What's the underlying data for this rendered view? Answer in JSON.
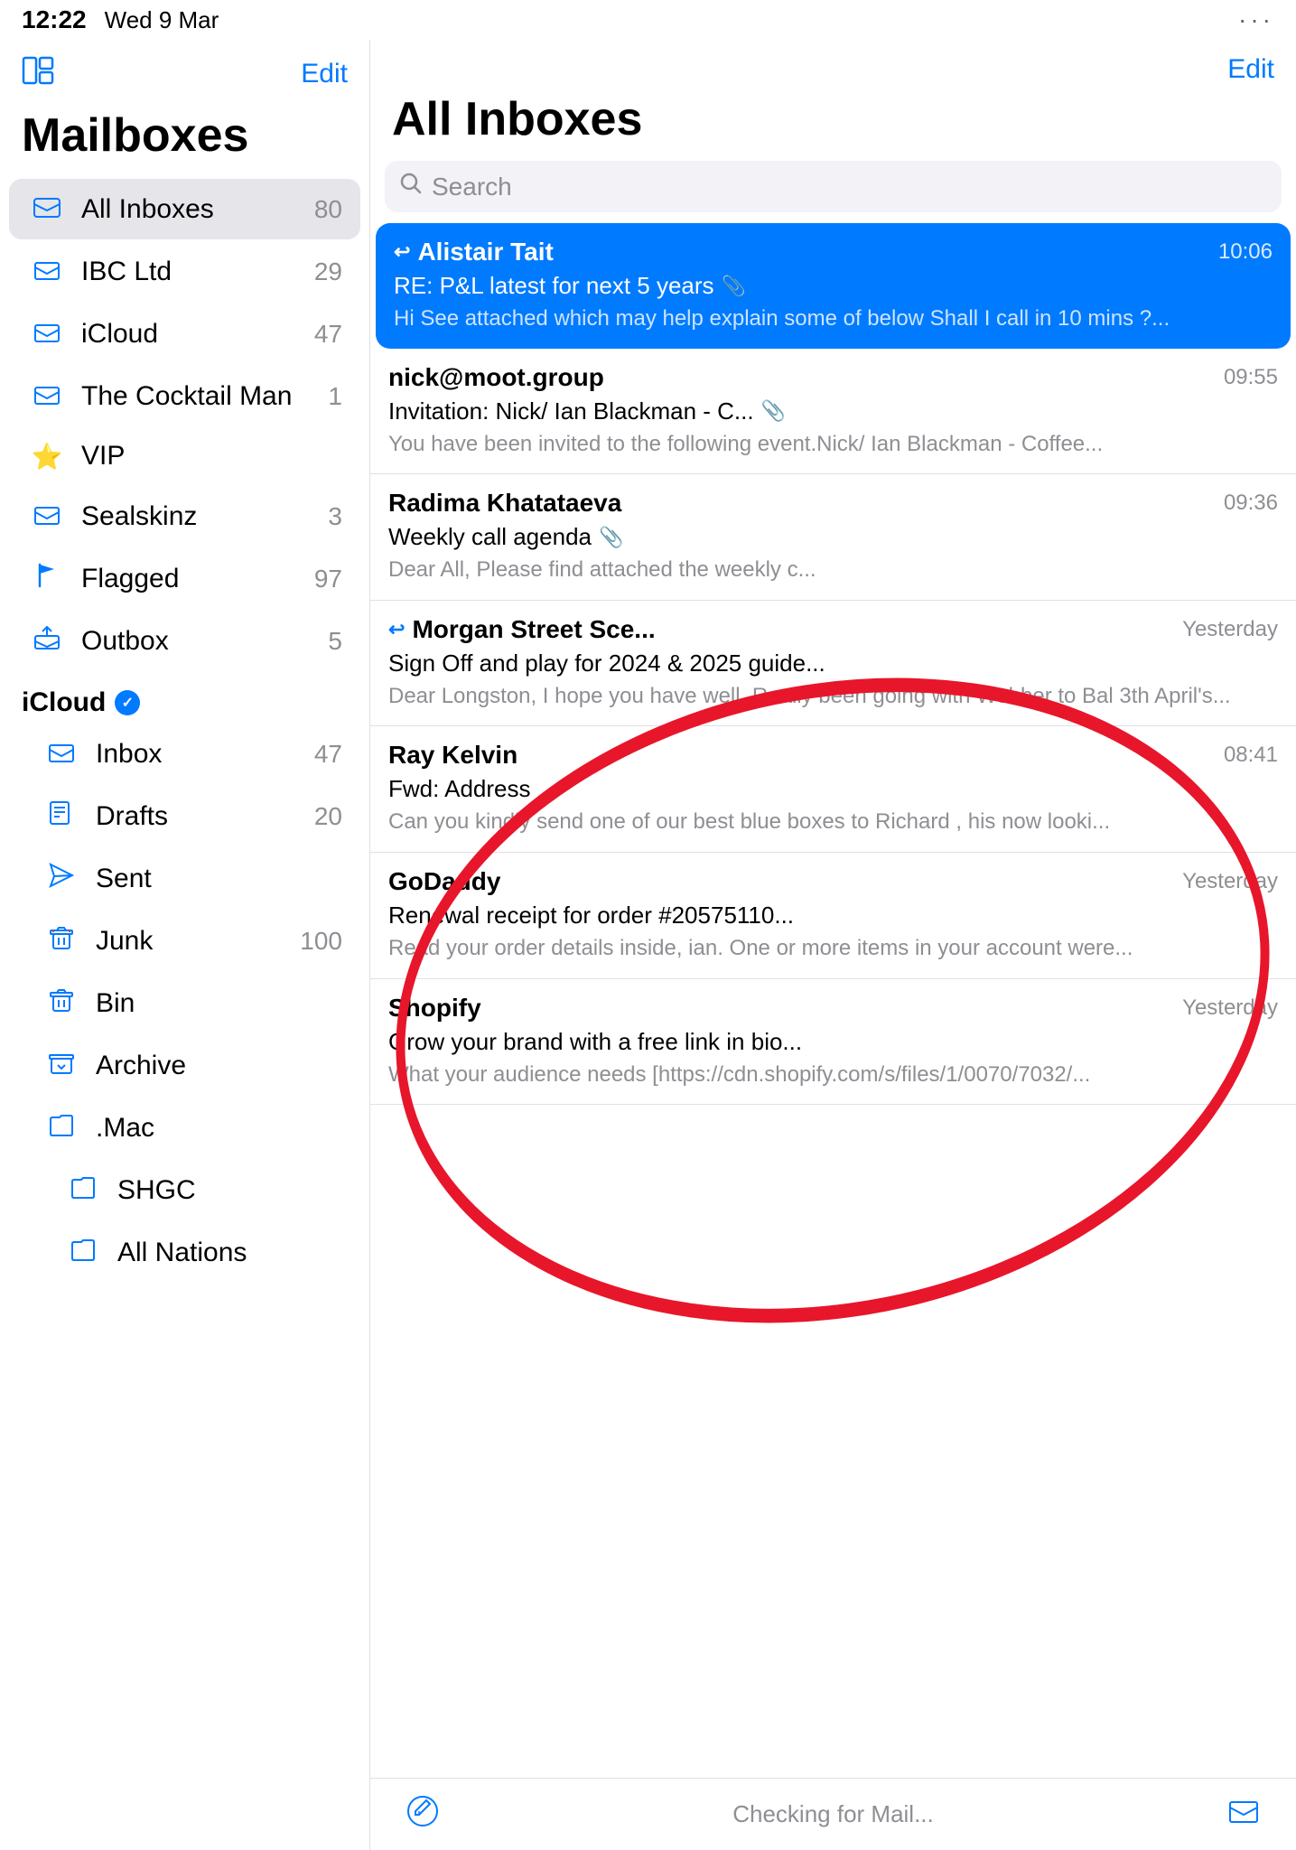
{
  "statusBar": {
    "time": "12:22",
    "date": "Wed 9 Mar",
    "dots": "···"
  },
  "sidebar": {
    "title": "Mailboxes",
    "editLabel": "Edit",
    "icon": "⊞",
    "items": [
      {
        "icon": "📥",
        "label": "All Inboxes",
        "count": "80",
        "active": true
      },
      {
        "icon": "📬",
        "label": "IBC Ltd",
        "count": "29",
        "active": false
      },
      {
        "icon": "📬",
        "label": "iCloud",
        "count": "47",
        "active": false
      },
      {
        "icon": "📬",
        "label": "The Cocktail Man",
        "count": "1",
        "active": false
      },
      {
        "icon": "⭐",
        "label": "VIP",
        "count": "",
        "active": false
      },
      {
        "icon": "📬",
        "label": "Sealskinz",
        "count": "3",
        "active": false
      },
      {
        "icon": "🚩",
        "label": "Flagged",
        "count": "97",
        "active": false
      },
      {
        "icon": "📤",
        "label": "Outbox",
        "count": "5",
        "active": false
      }
    ],
    "icloudSection": {
      "label": "iCloud",
      "items": [
        {
          "icon": "📥",
          "label": "Inbox",
          "count": "47"
        },
        {
          "icon": "📄",
          "label": "Drafts",
          "count": "20"
        },
        {
          "icon": "✈",
          "label": "Sent",
          "count": ""
        },
        {
          "icon": "🗑",
          "label": "Junk",
          "count": "100"
        },
        {
          "icon": "🗑",
          "label": "Bin",
          "count": ""
        },
        {
          "icon": "📦",
          "label": "Archive",
          "count": ""
        },
        {
          "icon": "📁",
          "label": ".Mac",
          "count": ""
        },
        {
          "icon": "📁",
          "label": "SHGC",
          "count": ""
        },
        {
          "icon": "📁",
          "label": "All Nations",
          "count": ""
        }
      ]
    }
  },
  "inbox": {
    "title": "All Inboxes",
    "editLabel": "Edit",
    "search": {
      "placeholder": "Search"
    },
    "emails": [
      {
        "id": 1,
        "sender": "Alistair Tait",
        "time": "10:06",
        "subject": "RE: P&L latest for next 5 years",
        "preview": "Hi See attached which may help explain some of below Shall I call in 10 mins ?...",
        "highlighted": true,
        "hasReply": true,
        "hasAttach": true
      },
      {
        "id": 2,
        "sender": "nick@moot.group",
        "time": "09:55",
        "subject": "Invitation: Nick/ Ian Blackman  - C...",
        "preview": "You have been invited to the following event.Nick/ Ian Blackman - Coffee...",
        "highlighted": false,
        "hasReply": false,
        "hasAttach": true
      },
      {
        "id": 3,
        "sender": "Radima Khatataeva",
        "time": "09:36",
        "subject": "Weekly call agenda",
        "preview": "Dear All, Please find attached the weekly c...",
        "highlighted": false,
        "hasReply": false,
        "hasAttach": true
      },
      {
        "id": 4,
        "sender": "Morgan Street Sce...",
        "time": "Yesterday",
        "subject": "Sign Off and play for 2024 & 2025 guide...",
        "preview": "Dear Longston, I hope you have well. Really been going with Webber to Bal 3th April's...",
        "highlighted": false,
        "hasReply": true,
        "hasAttach": false
      },
      {
        "id": 5,
        "sender": "Ray Kelvin",
        "time": "08:41",
        "subject": "Fwd: Address",
        "preview": "Can you kindly send one of our best blue boxes to Richard , his now looki...",
        "highlighted": false,
        "hasReply": false,
        "hasAttach": false
      },
      {
        "id": 6,
        "sender": "GoDaddy",
        "time": "Yesterday",
        "subject": "Renewal receipt for order #20575110...",
        "preview": "Read your order details inside, ian. One or more items in your account were...",
        "highlighted": false,
        "hasReply": false,
        "hasAttach": false
      },
      {
        "id": 7,
        "sender": "Shopify",
        "time": "Yesterday",
        "subject": "Grow your brand with a free link in bio...",
        "preview": "What your audience needs [https://cdn.shopify.com/s/files/1/0070/7032/...",
        "highlighted": false,
        "hasReply": false,
        "hasAttach": false
      }
    ],
    "bottomStatus": "Checking for Mail..."
  }
}
